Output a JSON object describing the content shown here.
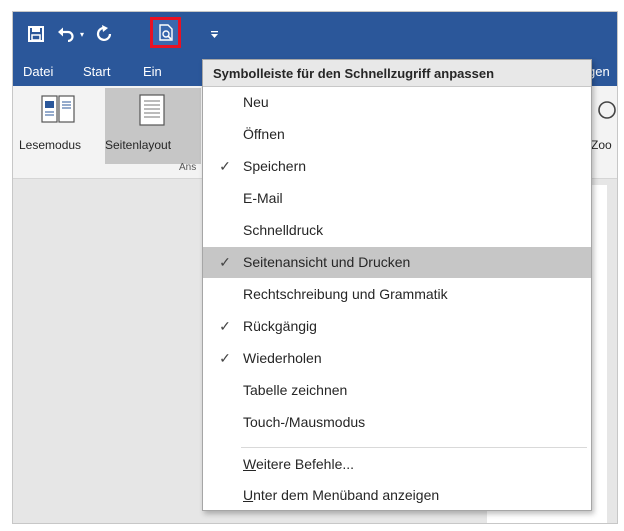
{
  "menubar": {
    "tabs": [
      "Datei",
      "Start",
      "Ein",
      "gen"
    ]
  },
  "ribbon": {
    "lesemodus": "Lesemodus",
    "seitenlayout": "Seitenlayout",
    "group_label": "Ans",
    "zoom": "Zoo"
  },
  "menu": {
    "header": "Symbolleiste für den Schnellzugriff anpassen",
    "items": [
      {
        "label": "Neu",
        "checked": false
      },
      {
        "label": "Öffnen",
        "checked": false
      },
      {
        "label": "Speichern",
        "checked": true
      },
      {
        "label": "E-Mail",
        "checked": false
      },
      {
        "label": "Schnelldruck",
        "checked": false
      },
      {
        "label": "Seitenansicht und Drucken",
        "checked": true
      },
      {
        "label": "Rechtschreibung und Grammatik",
        "checked": false
      },
      {
        "label": "Rückgängig",
        "checked": true
      },
      {
        "label": "Wiederholen",
        "checked": true
      },
      {
        "label": "Tabelle zeichnen",
        "checked": false
      },
      {
        "label": "Touch-/Mausmodus",
        "checked": false
      }
    ],
    "more_commands_mnemonic": "W",
    "more_commands_rest": "eitere Befehle...",
    "below_ribbon_mnemonic": "U",
    "below_ribbon_rest": "nter dem Menüband anzeigen",
    "check_glyph": "✓"
  },
  "colors": {
    "titlebar": "#2b579a",
    "highlight": "#c6c6c6",
    "callout": "#e81123"
  }
}
